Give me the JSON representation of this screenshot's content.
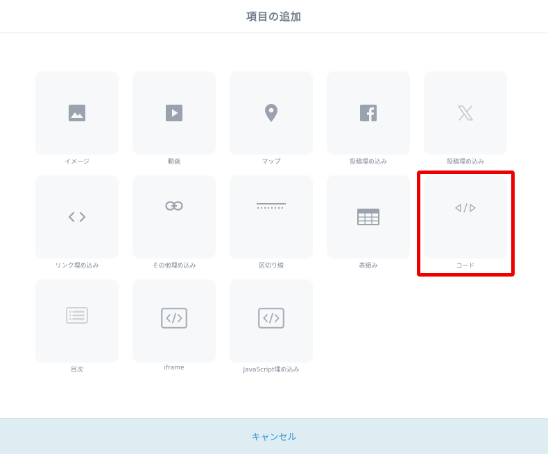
{
  "header": {
    "title": "項目の追加"
  },
  "items": [
    {
      "label": "イメージ",
      "icon": "image-icon"
    },
    {
      "label": "動画",
      "icon": "video-play-icon"
    },
    {
      "label": "マップ",
      "icon": "map-pin-icon"
    },
    {
      "label": "投稿埋め込み",
      "icon": "facebook-icon"
    },
    {
      "label": "投稿埋め込み",
      "icon": "x-logo-icon"
    },
    {
      "label": "リンク埋め込み",
      "icon": "angle-brackets-icon"
    },
    {
      "label": "その他埋め込み",
      "icon": "link-icon"
    },
    {
      "label": "区切り線",
      "icon": "divider-line-icon"
    },
    {
      "label": "表組み",
      "icon": "table-icon"
    },
    {
      "label": "コード",
      "icon": "code-icon"
    },
    {
      "label": "目次",
      "icon": "table-of-contents-icon"
    },
    {
      "label": "iframe",
      "icon": "code-box-icon"
    },
    {
      "label": "JavaScript埋め込み",
      "icon": "code-box-icon"
    }
  ],
  "highlighted_item": "コード",
  "footer": {
    "cancel_label": "キャンセル"
  },
  "colors": {
    "tile_background": "#f6f8f9",
    "icon": "#9aa3ad",
    "icon_light": "#cfd4d9",
    "highlight": "#ee0000",
    "footer_background": "#deedf1",
    "cancel_text": "#2f8fd8"
  }
}
